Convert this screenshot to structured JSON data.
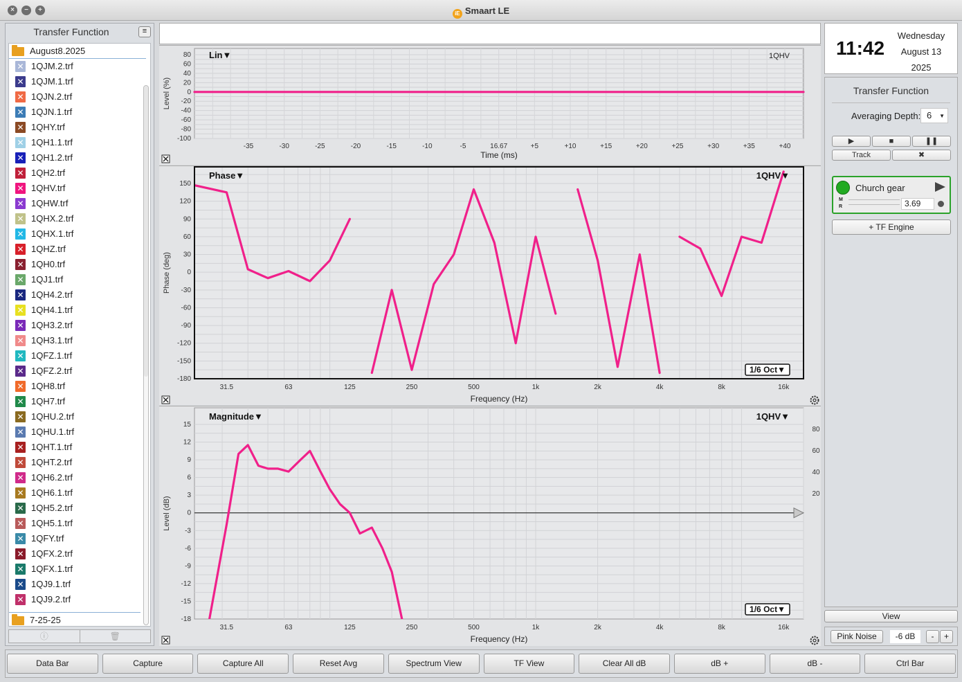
{
  "window": {
    "title": "Smaart LE",
    "logo_text": "iE"
  },
  "left_panel": {
    "title": "Transfer Function",
    "menu_icon": "hamburger-icon",
    "top_folder": "August8.2025",
    "files": [
      {
        "name": "1QJM.2.trf",
        "color": "#a9b7d8"
      },
      {
        "name": "1QJM.1.trf",
        "color": "#3b3b8c"
      },
      {
        "name": "1QJN.2.trf",
        "color": "#f06a45"
      },
      {
        "name": "1QJN.1.trf",
        "color": "#3c7cb6"
      },
      {
        "name": "1QHY.trf",
        "color": "#8b4a24"
      },
      {
        "name": "1QH1.1.trf",
        "color": "#9fd0e6"
      },
      {
        "name": "1QH1.2.trf",
        "color": "#1820b8"
      },
      {
        "name": "1QH2.trf",
        "color": "#c0203a"
      },
      {
        "name": "1QHV.trf",
        "color": "#f0157f"
      },
      {
        "name": "1QHW.trf",
        "color": "#8a3ad0"
      },
      {
        "name": "1QHX.2.trf",
        "color": "#c0c28a"
      },
      {
        "name": "1QHX.1.trf",
        "color": "#22b8e6"
      },
      {
        "name": "1QHZ.trf",
        "color": "#d8202a"
      },
      {
        "name": "1QH0.trf",
        "color": "#8a2030"
      },
      {
        "name": "1QJ1.trf",
        "color": "#6aa86a"
      },
      {
        "name": "1QH4.2.trf",
        "color": "#1a2880"
      },
      {
        "name": "1QH4.1.trf",
        "color": "#e8e020"
      },
      {
        "name": "1QH3.2.trf",
        "color": "#7a2ab8"
      },
      {
        "name": "1QH3.1.trf",
        "color": "#f08a8a"
      },
      {
        "name": "1QFZ.1.trf",
        "color": "#20b8c0"
      },
      {
        "name": "1QFZ.2.trf",
        "color": "#5a2a8a"
      },
      {
        "name": "1QH8.trf",
        "color": "#f06a2a"
      },
      {
        "name": "1QH7.trf",
        "color": "#208a4a"
      },
      {
        "name": "1QHU.2.trf",
        "color": "#8a6a20"
      },
      {
        "name": "1QHU.1.trf",
        "color": "#5a7ab0"
      },
      {
        "name": "1QHT.1.trf",
        "color": "#a82020"
      },
      {
        "name": "1QHT.2.trf",
        "color": "#c04a3a"
      },
      {
        "name": "1QH6.2.trf",
        "color": "#d02a8a"
      },
      {
        "name": "1QH6.1.trf",
        "color": "#a87a20"
      },
      {
        "name": "1QH5.2.trf",
        "color": "#2a6a4a"
      },
      {
        "name": "1QH5.1.trf",
        "color": "#b85a5a"
      },
      {
        "name": "1QFY.trf",
        "color": "#3a8aa8"
      },
      {
        "name": "1QFX.2.trf",
        "color": "#8a1a2a"
      },
      {
        "name": "1QFX.1.trf",
        "color": "#1a7a6a"
      },
      {
        "name": "1QJ9.1.trf",
        "color": "#1a4a8a"
      },
      {
        "name": "1QJ9.2.trf",
        "color": "#c0306a"
      }
    ],
    "bottom_folder": "7-25-25",
    "footer_icons": [
      "info-icon",
      "trash-icon"
    ]
  },
  "impulse_plot": {
    "label": "Lin▼",
    "trace_name": "1QHV",
    "ylabel": "Level (%)",
    "xlabel": "Time (ms)",
    "y_ticks": [
      "80",
      "60",
      "40",
      "20",
      "0",
      "-20",
      "-40",
      "-60",
      "-80",
      "-100"
    ],
    "x_ticks": [
      "-35",
      "-30",
      "-25",
      "-20",
      "-15",
      "-10",
      "-5",
      "16.67",
      "+5",
      "+10",
      "+15",
      "+20",
      "+25",
      "+30",
      "+35",
      "+40"
    ]
  },
  "phase_plot": {
    "label": "Phase▼",
    "trace_name": "1QHV▼",
    "ylabel": "Phase (deg)",
    "xlabel": "Frequency (Hz)",
    "smoothing": "1/6 Oct▼",
    "y_ticks": [
      "150",
      "120",
      "90",
      "60",
      "30",
      "0",
      "-30",
      "-60",
      "-90",
      "-120",
      "-150",
      "-180"
    ],
    "x_ticks": [
      "31.5",
      "63",
      "125",
      "250",
      "500",
      "1k",
      "2k",
      "4k",
      "8k",
      "16k"
    ]
  },
  "magnitude_plot": {
    "label": "Magnitude▼",
    "trace_name": "1QHV▼",
    "ylabel": "Level (dB)",
    "xlabel": "Frequency (Hz)",
    "smoothing": "1/6 Oct▼",
    "y_ticks": [
      "15",
      "12",
      "9",
      "6",
      "3",
      "0",
      "-3",
      "-6",
      "-9",
      "-12",
      "-15",
      "-18"
    ],
    "right_ticks": [
      "80",
      "60",
      "40",
      "20"
    ],
    "x_ticks": [
      "31.5",
      "63",
      "125",
      "250",
      "500",
      "1k",
      "2k",
      "4k",
      "8k",
      "16k"
    ]
  },
  "chart_data": [
    {
      "type": "line",
      "title": "",
      "xlabel": "Time (ms)",
      "ylabel": "Level (%)",
      "ylim": [
        -100,
        80
      ],
      "series": [
        {
          "name": "1QHV",
          "x": [
            -40,
            -20,
            0,
            20,
            45
          ],
          "y": [
            0,
            0,
            0,
            0,
            0
          ]
        }
      ]
    },
    {
      "type": "line",
      "title": "",
      "xlabel": "Frequency (Hz)",
      "ylabel": "Phase (deg)",
      "ylim": [
        -180,
        180
      ],
      "x_scale": "log",
      "series": [
        {
          "name": "1QHV",
          "x": [
            22,
            31.5,
            40,
            50,
            63,
            80,
            100,
            125,
            160,
            200,
            250,
            320,
            400,
            500,
            630,
            800,
            1000,
            1250,
            1600,
            2000,
            2500,
            3200,
            4000,
            5000,
            6300,
            8000,
            10000,
            12500,
            16000
          ],
          "y": [
            147,
            135,
            5,
            -10,
            2,
            -15,
            20,
            90,
            -170,
            -30,
            -165,
            -20,
            30,
            140,
            50,
            -120,
            60,
            -70,
            140,
            20,
            -160,
            30,
            -170,
            60,
            40,
            -40,
            60,
            50,
            170
          ]
        }
      ]
    },
    {
      "type": "line",
      "title": "",
      "xlabel": "Frequency (Hz)",
      "ylabel": "Level (dB)",
      "ylim": [
        -18,
        15
      ],
      "x_scale": "log",
      "series": [
        {
          "name": "1QHV",
          "x": [
            26,
            31.5,
            36,
            40,
            45,
            50,
            56,
            63,
            72,
            80,
            90,
            100,
            112,
            125,
            140,
            160,
            180,
            200,
            224
          ],
          "y": [
            -18,
            -2,
            10,
            11.5,
            8,
            7.5,
            7.5,
            7,
            9,
            10.5,
            7,
            4,
            1.5,
            0,
            -3.5,
            -2.5,
            -6,
            -10,
            -18
          ]
        }
      ]
    }
  ],
  "clock": {
    "time": "11:42",
    "day": "Wednesday",
    "date": "August 13",
    "year": "2025"
  },
  "tf_panel": {
    "title": "Transfer Function",
    "averaging_label": "Averaging Depth:",
    "averaging_value": "6",
    "transport": [
      "play-icon",
      "stop-icon",
      "pause-icon"
    ],
    "track_label": "Track",
    "tools_icon": "tools-icon",
    "engine_name": "Church gear",
    "engine_m": "M",
    "engine_r": "R",
    "engine_value": "3.69",
    "tf_engine_button": "+ TF Engine",
    "accent": "#2aa22a"
  },
  "view_button": "View",
  "noise": {
    "button": "Pink Noise",
    "value": "-6 dB",
    "minus": "-",
    "plus": "+"
  },
  "bottom_bar": [
    "Data Bar",
    "Capture",
    "Capture All",
    "Reset Avg",
    "Spectrum View",
    "TF View",
    "Clear All dB",
    "dB +",
    "dB -",
    "Ctrl Bar"
  ],
  "colors": {
    "trace": "#f0208a",
    "background": "#e3e4e6"
  }
}
